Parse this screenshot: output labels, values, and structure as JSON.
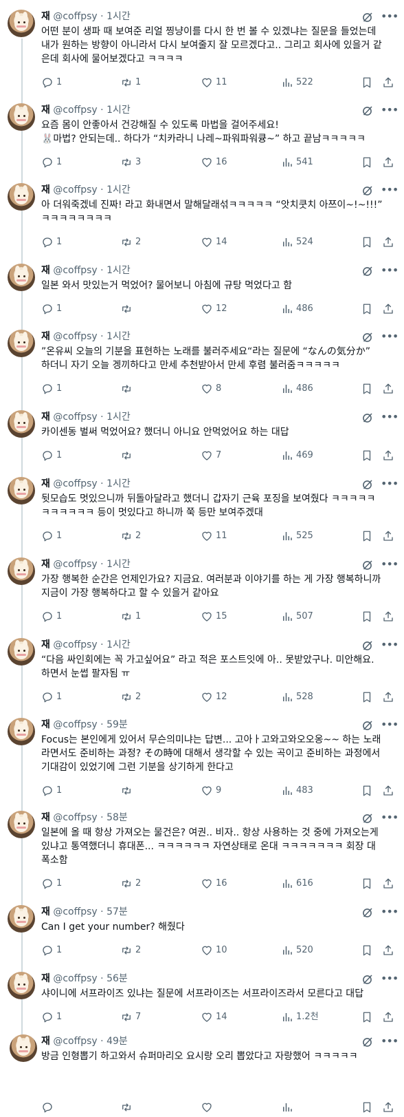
{
  "author": {
    "name": "재",
    "handle": "@coffpsy"
  },
  "tweets": [
    {
      "time": "1시간",
      "text": "어떤 분이 생파 때 보여준 리얼 찡냥이를 다시 한 번 볼 수 있겠냐는 질문을 들었는데\n내가 원하는 방향이 아니라서 다시 보여줄지 잘 모르겠다고.. 그리고 회사에 있을거 같\n은데 회사에 물어보겠다고 ㅋㅋㅋㅋ",
      "replies": "1",
      "retweets": "1",
      "likes": "11",
      "views": "522"
    },
    {
      "time": "1시간",
      "text": "요즘 몸이 안좋아서 건강해질 수 있도록 마법을 걸어주세요!\n🐰마법? 안되는데.. 하다가 “치카라니 나레~파워파워큥~” 하고 끝남ㅋㅋㅋㅋㅋ",
      "replies": "1",
      "retweets": "3",
      "likes": "16",
      "views": "541"
    },
    {
      "time": "1시간",
      "text": "아 더워죽겠네 진짜! 라고 화내면서 말해달래섞ㅋㅋㅋㅋㅋ “앗치쿳치 아쯔이~!~!!!”\nㅋㅋㅋㅋㅋㅋㅋㅋ",
      "replies": "1",
      "retweets": "2",
      "likes": "14",
      "views": "524"
    },
    {
      "time": "1시간",
      "text": "일본 와서 맛있는거 먹었어? 물어보니 아침에 규탕 먹었다고 함",
      "replies": "1",
      "retweets": "",
      "likes": "12",
      "views": "486"
    },
    {
      "time": "1시간",
      "text": "”온유씨 오늘의 기분을 표현하는 노래를 불러주세요“라는 질문에 “なんの気分か”\n하더니 자기 오늘 겡끼하다고 만세 추천받아서 만세 후렴 불러줌ㅋㅋㅋㅋㅋ",
      "replies": "1",
      "retweets": "",
      "likes": "8",
      "views": "486"
    },
    {
      "time": "1시간",
      "text": "카이센동 벌써 먹었어요? 했더니 아니요 안먹었어요 하는 대답",
      "replies": "1",
      "retweets": "",
      "likes": "7",
      "views": "469"
    },
    {
      "time": "1시간",
      "text": "뒷모습도 멋있으니까 뒤돌아달라고 했더니 갑자기 근육 포징을 보여줬다 ㅋㅋㅋㅋㅋ\nㅋㅋㅋㅋㅋㅋ 등이 멋있다고 하니까 쭉 등만 보여주겠대",
      "replies": "1",
      "retweets": "2",
      "likes": "11",
      "views": "525"
    },
    {
      "time": "1시간",
      "text": "가장 행복한 순간은 언제인가요? 지금요. 여러분과 이야기를 하는 게 가장 행복하니까\n지금이 가장 행복하다고 할 수 있을거 같아요",
      "replies": "1",
      "retweets": "1",
      "likes": "15",
      "views": "507"
    },
    {
      "time": "1시간",
      "text": "“다음 싸인회에는 꼭 가고싶어요” 라고 적은 포스트잇에 아.. 못받았구나. 미안해요.\n하면서 눈썹 팔자됨 ㅠ",
      "replies": "1",
      "retweets": "2",
      "likes": "12",
      "views": "528"
    },
    {
      "time": "59분",
      "text": "Focus는 본인에게 있어서 무슨의미냐는 답변... 고아ㅏ고와고와오오옹~~ 하는 노래\n라면서도 준비하는 과정? その時에 대해서 생각할 수 있는 곡이고 준비하는 과정에서\n기대감이 있었기에 그런 기분을 상기하게 한다고",
      "replies": "1",
      "retweets": "",
      "likes": "9",
      "views": "483"
    },
    {
      "time": "58분",
      "text": "일본에 올 때 항상 가져오는 물건은? 여권.. 비자.. 항상 사용하는 것 중에 가져오는게\n있냐고 통역했더니 휴대폰... ㅋㅋㅋㅋㅋㅋ 자연상태로 온대 ㅋㅋㅋㅋㅋㅋㅋ 회장 대\n폭소함",
      "replies": "1",
      "retweets": "2",
      "likes": "16",
      "views": "616"
    },
    {
      "time": "57분",
      "text": "Can I get your number? 해줬다",
      "replies": "1",
      "retweets": "2",
      "likes": "10",
      "views": "520"
    },
    {
      "time": "56분",
      "text": "샤이니에 서프라이즈 있냐는 질문에 서프라이즈는 서프라이즈라서 모른다고 대답",
      "replies": "1",
      "retweets": "7",
      "likes": "14",
      "views": "1.2천"
    },
    {
      "time": "49분",
      "text": "방금 인형뽑기 하고와서 슈퍼마리오 요시랑 오리 뽑았다고 자랑했어 ㅋㅋㅋㅋㅋ",
      "replies": "",
      "retweets": "",
      "likes": "",
      "views": ""
    }
  ],
  "icons": {
    "reply": "reply-icon",
    "retweet": "retweet-icon",
    "like": "heart-icon",
    "views": "views-icon",
    "bookmark": "bookmark-icon",
    "share": "share-icon",
    "grok": "grok-icon",
    "more": "more-icon"
  },
  "colors": {
    "text": "#0f1419",
    "secondary": "#536471",
    "thread_line": "#cfd9de"
  }
}
